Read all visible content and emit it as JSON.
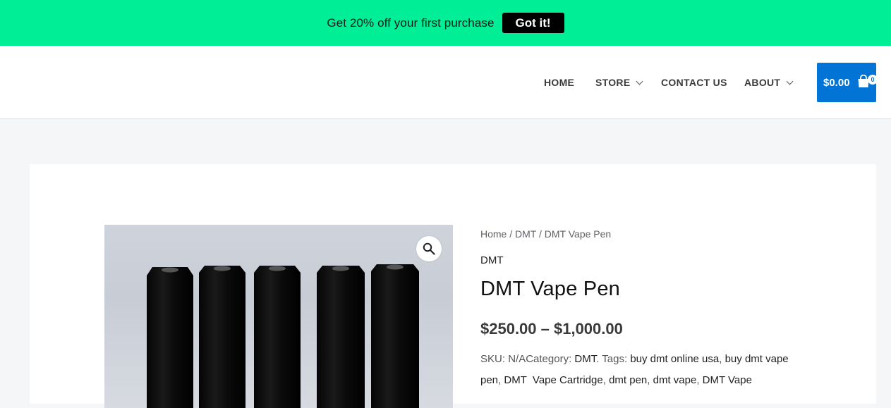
{
  "promo": {
    "text": "Get 20% off your first purchase",
    "button": "Got it!"
  },
  "nav": {
    "items": [
      {
        "label": "HOME"
      },
      {
        "label": "STORE"
      },
      {
        "label": "CONTACT US"
      },
      {
        "label": "ABOUT"
      }
    ]
  },
  "cart": {
    "total": "$0.00",
    "count": "0"
  },
  "breadcrumb": {
    "home": "Home",
    "sep1": " / ",
    "category": "DMT",
    "sep2": " / ",
    "current": "DMT Vape Pen"
  },
  "product": {
    "category": "DMT",
    "title": "DMT Vape Pen",
    "price": "$250.00 – $1,000.00",
    "sku_label": "SKU: ",
    "sku": "N/A",
    "category_label": "Category: ",
    "category_link": "DMT",
    "tags_label": ". Tags: ",
    "tags": [
      "buy dmt online usa",
      "buy dmt vape pen",
      "DMT  Vape Cartridge",
      "dmt pen",
      "dmt vape",
      "DMT Vape"
    ]
  },
  "colors": {
    "promo_bg": "#00ee95",
    "cart_bg": "#0274d6"
  },
  "icons": {
    "zoom": "magnifier-icon",
    "cart": "shopping-bag-icon"
  }
}
